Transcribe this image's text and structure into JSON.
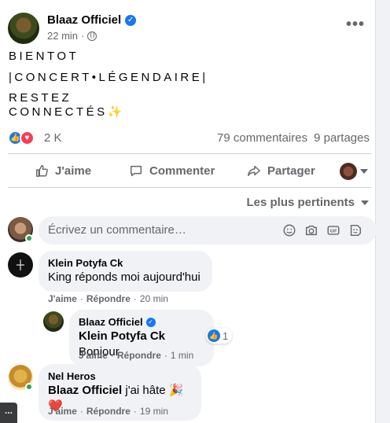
{
  "post": {
    "author": "Blaaz Officiel",
    "time": "22 min",
    "lines": [
      "BIENTOT",
      "|CONCERT•LÉGENDAIRE|",
      "RESTEZ",
      "CONNECTÉS✨"
    ],
    "reaction_count": "2 K",
    "comments_count": "79 commentaires",
    "shares_count": "9 partages"
  },
  "actions": {
    "like": "J'aime",
    "comment": "Commenter",
    "share": "Partager"
  },
  "sort_label": "Les plus pertinents",
  "composer": {
    "placeholder": "Écrivez un commentaire…"
  },
  "comments": [
    {
      "name": "Klein Potyfa Ck",
      "text": "King réponds moi aujourd'hui",
      "like": "J'aime",
      "reply": "Répondre",
      "time": "20 min"
    },
    {
      "name": "Blaaz Officiel",
      "mention": "Klein Potyfa Ck",
      "text": "Bonjour",
      "reactions": "1",
      "like": "J'aime",
      "reply": "Répondre",
      "time": "1 min"
    },
    {
      "name": "Nel Heros",
      "mention": "Blaaz Officiel",
      "text": "j'ai hâte 🎉❤️",
      "like": "J'aime",
      "reply": "Répondre",
      "time": "19 min"
    }
  ],
  "chat_tab": "...",
  "colors": {
    "accent": "#1877f2",
    "love": "#f33e58",
    "online": "#31a24c",
    "muted": "#65676b"
  }
}
